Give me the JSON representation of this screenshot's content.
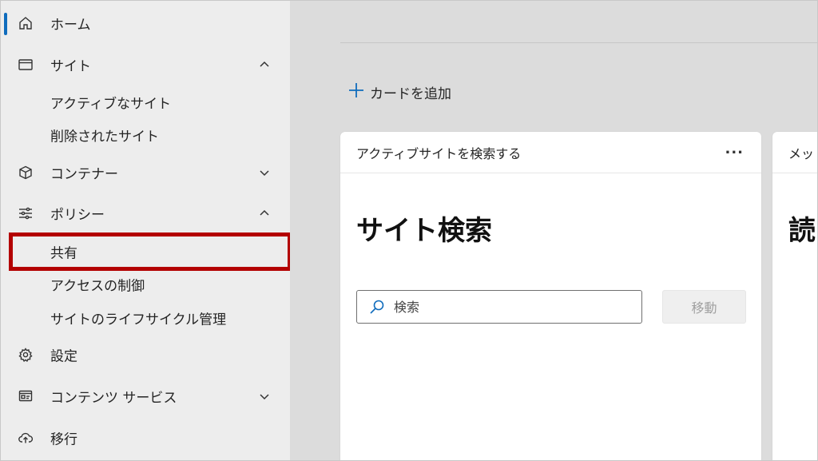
{
  "sidebar": {
    "home": "ホーム",
    "sites": "サイト",
    "active_sites": "アクティブなサイト",
    "deleted_sites": "削除されたサイト",
    "containers": "コンテナー",
    "policies": "ポリシー",
    "sharing": "共有",
    "access_control": "アクセスの制御",
    "site_lifecycle": "サイトのライフサイクル管理",
    "settings": "設定",
    "content_services": "コンテンツ サービス",
    "migration": "移行"
  },
  "main": {
    "add_card": "カードを追加",
    "card1": {
      "title": "アクティブサイトを検索する",
      "more": "···",
      "heading": "サイト検索",
      "search_placeholder": "検索",
      "go_button": "移動"
    },
    "card2": {
      "title": "メッ",
      "heading": "読"
    }
  },
  "colors": {
    "accent": "#0f6cbd",
    "highlight": "#b30000",
    "sidebar_bg": "#ededed",
    "main_bg": "#dcdcdc"
  }
}
